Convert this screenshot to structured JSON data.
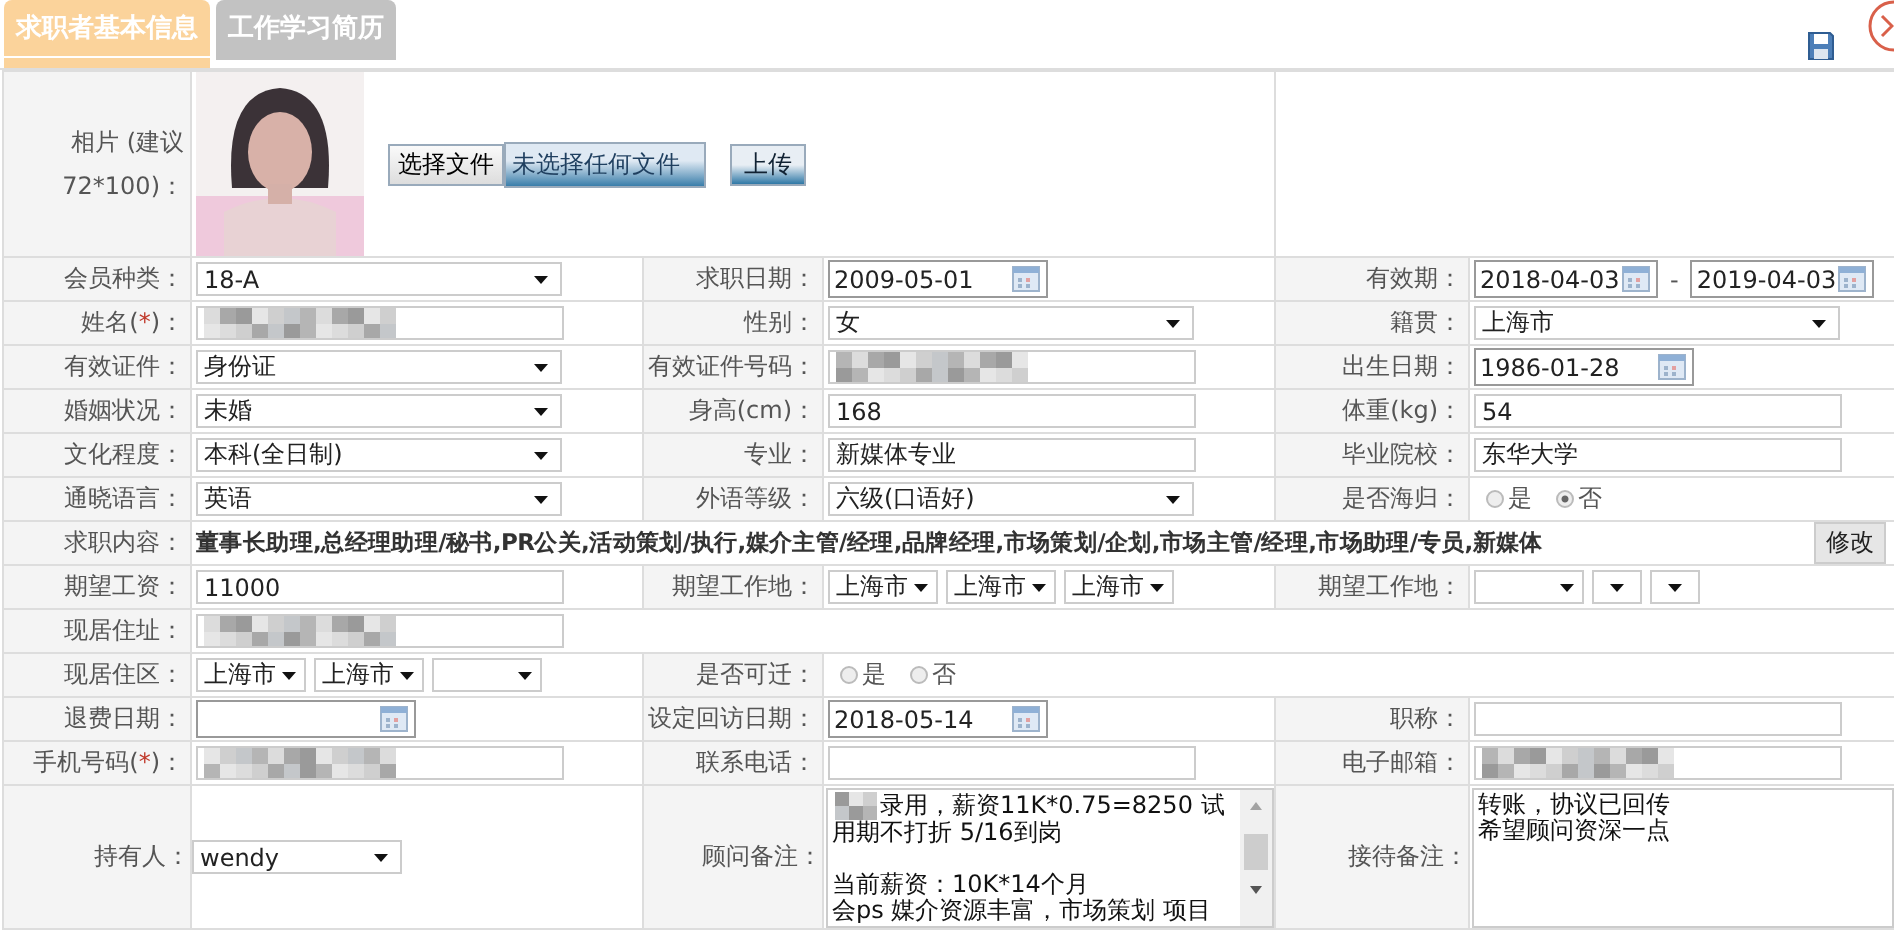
{
  "tabs": [
    {
      "label": "求职者基本信息",
      "selected": true
    },
    {
      "label": "工作学习简历",
      "selected": false
    }
  ],
  "photo": {
    "label": "相片 (建议72*100)：",
    "file_button": "选择文件",
    "file_status": "未选择任何文件",
    "upload_button": "上传"
  },
  "rows": [
    {
      "cells": [
        {
          "label": "会员种类：",
          "field": {
            "kind": "select",
            "value": "18-A"
          }
        },
        {
          "label": "求职日期：",
          "field": {
            "kind": "date",
            "value": "2009-05-01"
          }
        },
        {
          "label": "有效期：",
          "field": {
            "kind": "date_range",
            "from": "2018-04-03",
            "separator": "-",
            "to": "2019-04-03"
          }
        }
      ]
    },
    {
      "cells": [
        {
          "label": "姓名(",
          "required_mark": "*",
          "label_tail": ")：",
          "field": {
            "kind": "text",
            "redacted": true
          }
        },
        {
          "label": "性别：",
          "field": {
            "kind": "select",
            "value": "女"
          }
        },
        {
          "label": "籍贯：",
          "field": {
            "kind": "select",
            "value": "上海市"
          }
        }
      ]
    },
    {
      "cells": [
        {
          "label": "有效证件：",
          "field": {
            "kind": "select",
            "value": "身份证"
          }
        },
        {
          "label": "有效证件号码：",
          "field": {
            "kind": "text",
            "redacted": true
          }
        },
        {
          "label": "出生日期：",
          "field": {
            "kind": "date",
            "value": "1986-01-28"
          }
        }
      ]
    },
    {
      "cells": [
        {
          "label": "婚姻状况：",
          "field": {
            "kind": "select",
            "value": "未婚"
          }
        },
        {
          "label": "身高(cm)：",
          "field": {
            "kind": "text",
            "value": "168"
          }
        },
        {
          "label": "体重(kg)：",
          "field": {
            "kind": "text",
            "value": "54"
          }
        }
      ]
    },
    {
      "cells": [
        {
          "label": "文化程度：",
          "field": {
            "kind": "select",
            "value": "本科(全日制)"
          }
        },
        {
          "label": "专业：",
          "field": {
            "kind": "text",
            "value": "新媒体专业"
          }
        },
        {
          "label": "毕业院校：",
          "field": {
            "kind": "text",
            "value": "东华大学"
          }
        }
      ]
    },
    {
      "cells": [
        {
          "label": "通晓语言：",
          "field": {
            "kind": "select",
            "value": "英语"
          }
        },
        {
          "label": "外语等级：",
          "field": {
            "kind": "select",
            "value": "六级(口语好)"
          }
        },
        {
          "label": "是否海归：",
          "field": {
            "kind": "radio",
            "options": [
              {
                "label": "是",
                "selected": false
              },
              {
                "label": "否",
                "selected": true
              }
            ]
          }
        }
      ]
    },
    {
      "cells": [
        {
          "label": "求职内容：",
          "field": {
            "kind": "summary",
            "value": "董事长助理,总经理助理/秘书,PR公关,活动策划/执行,媒介主管/经理,品牌经理,市场策划/企划,市场主管/经理,市场助理/专员,新媒体",
            "action": "修改"
          }
        }
      ]
    },
    {
      "cells": [
        {
          "label": "期望工资：",
          "field": {
            "kind": "text",
            "value": "11000"
          }
        },
        {
          "label": "期望工作地：",
          "field": {
            "kind": "selects",
            "options": [
              {
                "value": "上海市"
              },
              {
                "value": "上海市"
              },
              {
                "value": "上海市"
              }
            ]
          }
        },
        {
          "label": "期望工作地：",
          "field": {
            "kind": "selects",
            "options": [
              {
                "empty": true
              },
              {
                "empty": true
              },
              {
                "empty": true
              }
            ]
          }
        }
      ]
    },
    {
      "cells": [
        {
          "label": "现居住址：",
          "field": {
            "kind": "text",
            "redacted": true
          }
        }
      ]
    },
    {
      "cells": [
        {
          "label": "现居住区：",
          "field": {
            "kind": "selects",
            "options": [
              {
                "value": "上海市"
              },
              {
                "value": "上海市"
              },
              {
                "empty": true
              }
            ]
          }
        },
        {
          "label": "是否可迁：",
          "field": {
            "kind": "radio",
            "options": [
              {
                "label": "是",
                "selected": false
              },
              {
                "label": "否",
                "selected": false
              }
            ]
          }
        }
      ]
    },
    {
      "cells": [
        {
          "label": "退费日期：",
          "field": {
            "kind": "date"
          }
        },
        {
          "label": "设定回访日期：",
          "field": {
            "kind": "date",
            "value": "2018-05-14"
          }
        },
        {
          "label": "职称：",
          "field": {
            "kind": "text"
          }
        }
      ]
    },
    {
      "cells": [
        {
          "label": "手机号码(",
          "required_mark": "*",
          "label_tail": ")：",
          "field": {
            "kind": "text",
            "redacted": true
          }
        },
        {
          "label": "联系电话：",
          "field": {
            "kind": "text"
          }
        },
        {
          "label": "电子邮箱：",
          "field": {
            "kind": "text",
            "redacted": true
          }
        }
      ]
    },
    {
      "kind": "notes",
      "cells": [
        {
          "label": "持有人：",
          "field": {
            "kind": "select",
            "value": "wendy"
          }
        },
        {
          "label": "顾问备注：",
          "field": {
            "kind": "textarea",
            "redacted_prefix": true,
            "scrollbar": true,
            "paragraphs": [
              [
                "录用，薪资11K*0.75=8250 试用期不打折 5/16到岗"
              ],
              [
                "当前薪资：10K*14个月",
                "会ps 媒介资源丰富，市场策划 项目"
              ]
            ]
          }
        },
        {
          "label": "接待备注：",
          "field": {
            "kind": "textarea",
            "scrollbar": false,
            "paragraphs": [
              [
                "转账，协议已回传",
                "希望顾问资深一点"
              ]
            ]
          }
        }
      ]
    }
  ]
}
